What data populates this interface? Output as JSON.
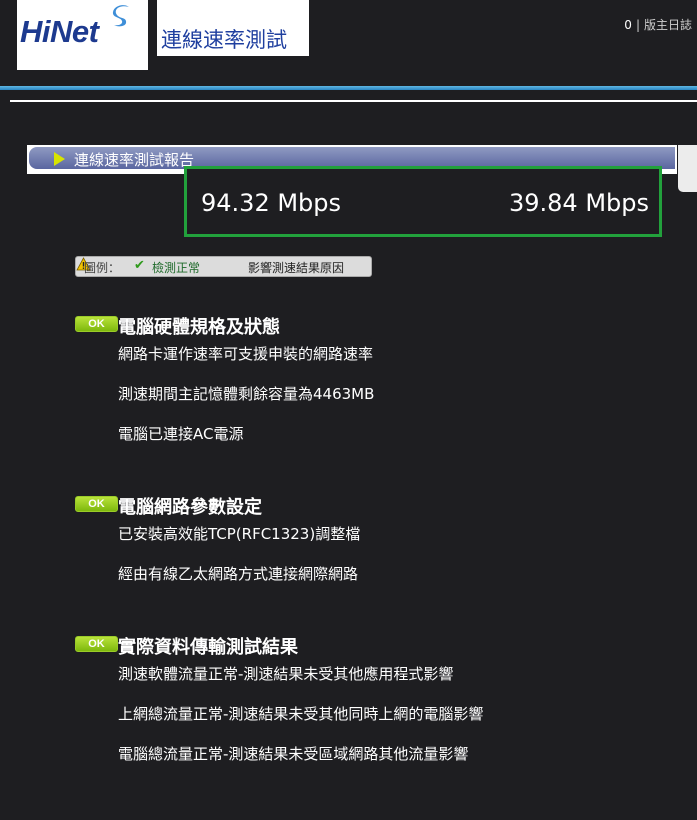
{
  "header": {
    "logo_text": "HiNet",
    "app_title": "連線速率測試",
    "count": "0",
    "separator": "|",
    "copyright_link": "版主日誌"
  },
  "report": {
    "title": "連線速率測試報告",
    "download_speed": "94.32 Mbps",
    "upload_speed": "39.84 Mbps"
  },
  "legend": {
    "label": "圖例：",
    "ok_icon": "checkmark-icon",
    "ok_text": "檢測正常",
    "warn_icon": "warning-icon",
    "warn_text": "影響測速結果原因"
  },
  "sections": [
    {
      "badge": "OK",
      "title": "電腦硬體規格及狀態",
      "items": [
        "網路卡運作速率可支援申裝的網路速率",
        "測速期間主記憶體剩餘容量為4463MB",
        "電腦已連接AC電源"
      ]
    },
    {
      "badge": "OK",
      "title": "電腦網路參數設定",
      "items": [
        "已安裝高效能TCP(RFC1323)調整檔",
        "經由有線乙太網路方式連接網際網路"
      ]
    },
    {
      "badge": "OK",
      "title": "實際資料傳輸測試結果",
      "items": [
        "測速軟體流量正常-測速結果未受其他應用程式影響",
        "上網總流量正常-測速結果未受其他同時上網的電腦影響",
        "電腦總流量正常-測速結果未受區域網路其他流量影響"
      ]
    }
  ],
  "colors": {
    "background": "#1e1e21",
    "accent_blue": "#2a86c2",
    "highlight_green": "#22a13c",
    "ok_badge": "#8cc414"
  }
}
